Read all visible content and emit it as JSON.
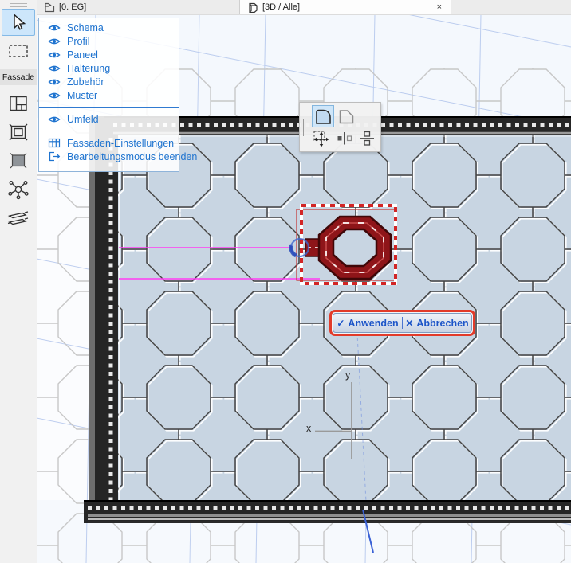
{
  "tabs": {
    "floorplan": {
      "label": "[0. EG]",
      "icon": "story-flag-icon"
    },
    "view3d": {
      "label": "[3D / Alle]",
      "icon": "cube-3d-icon",
      "close_glyph": "×"
    }
  },
  "toolbox": {
    "group_label": "Fassade",
    "tools": [
      "select-arrow",
      "marquee",
      "scheme-grid",
      "frame",
      "panel-fill",
      "junction-node",
      "louvre-stack"
    ]
  },
  "menu": {
    "items": [
      "Schema",
      "Profil",
      "Paneel",
      "Halterung",
      "Zubehör",
      "Muster"
    ],
    "umfeld": "Umfeld",
    "settings": "Fassaden-Einstellungen",
    "exit": "Bearbeitungsmodus beenden"
  },
  "pet_palette": {
    "icons": [
      "boundary-solid-icon",
      "boundary-outline-icon",
      "move-drag-icon",
      "mirror-icon",
      "distribute-icon"
    ],
    "selected": "boundary-solid-icon"
  },
  "apply_bar": {
    "apply_label": "Anwenden",
    "apply_glyph": "✓",
    "cancel_label": "Abbrechen",
    "cancel_glyph": "✕"
  },
  "axis": {
    "x_label": "x",
    "y_label": "y"
  },
  "colors": {
    "accent_blue": "#1e73cf",
    "selection_red": "#8e1519",
    "marquee_red": "#d22",
    "magenta_guides": "#ff3df2",
    "facade_fill": "#c8d5e2",
    "frame_dark": "#262626"
  }
}
